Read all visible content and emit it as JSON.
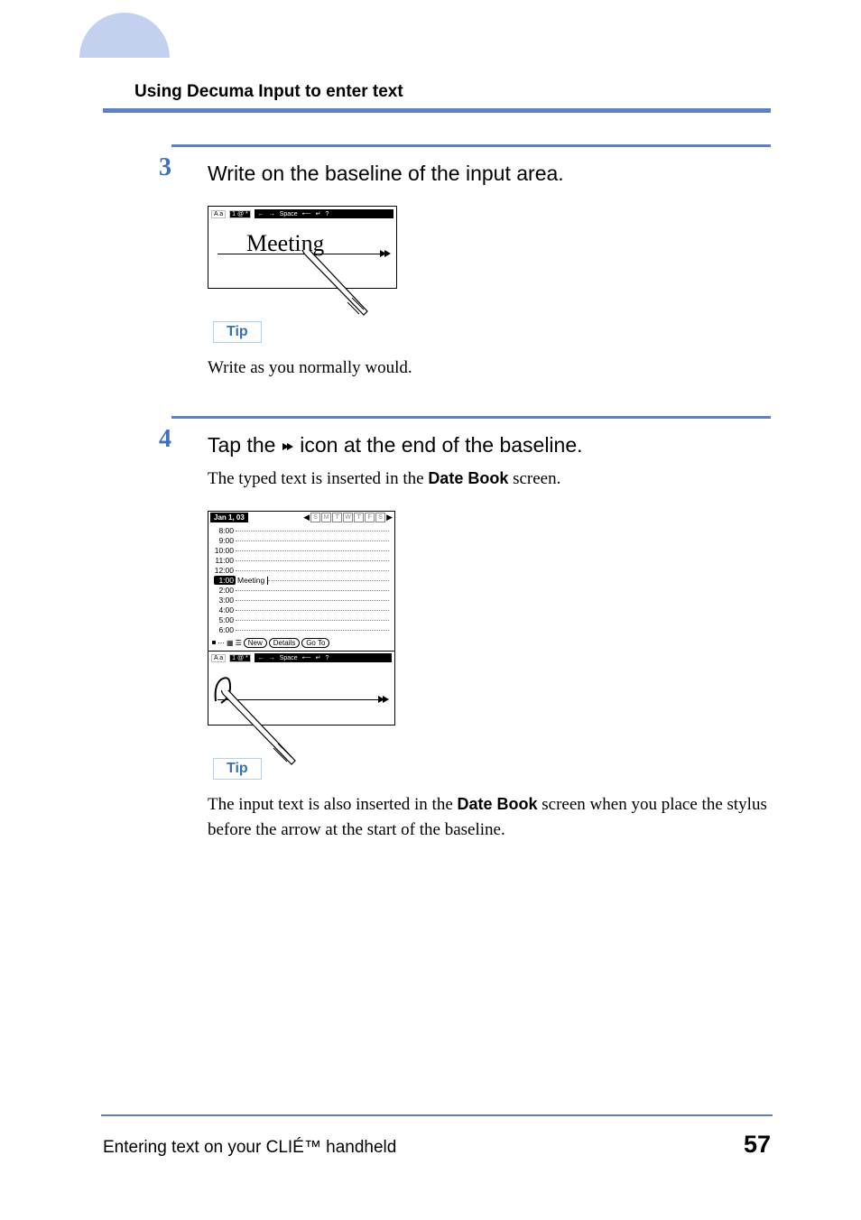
{
  "header": {
    "title": "Using Decuma Input to enter text"
  },
  "step3": {
    "number": "3",
    "heading": "Write on the baseline of the input area.",
    "tip_label": "Tip",
    "tip_text": "Write as you normally would.",
    "figure": {
      "toolbar": {
        "mode_text": "A a",
        "mode_num": "1 @ *",
        "actions": [
          "←",
          "→",
          "Space",
          "⟵",
          "↵",
          "?"
        ]
      },
      "written": "Meetin"
    }
  },
  "step4": {
    "number": "4",
    "heading_prefix": "Tap the ",
    "heading_suffix": " icon at the end of the baseline.",
    "body_prefix": "The typed text is inserted in the ",
    "body_bold": "Date Book",
    "body_suffix": " screen.",
    "figure": {
      "date": "Jan 1, 03",
      "weekdays": [
        "S",
        "M",
        "T",
        "W",
        "T",
        "F",
        "S"
      ],
      "hours": [
        "8:00",
        "9:00",
        "10:00",
        "11:00",
        "12:00"
      ],
      "selected": {
        "time": "1:00",
        "text": "Meeting"
      },
      "hours2": [
        "2:00",
        "3:00",
        "4:00",
        "5:00",
        "6:00"
      ],
      "buttons": [
        "New",
        "Details",
        "Go To"
      ],
      "toolbar": {
        "mode_text": "A a",
        "mode_num": "1 @ *",
        "actions": [
          "←",
          "→",
          "Space",
          "⟵",
          "↵",
          "?"
        ]
      }
    },
    "tip_label": "Tip",
    "tip_text_prefix": "The input text is also inserted in the ",
    "tip_bold": "Date Book",
    "tip_text_suffix": " screen when you place the stylus before the arrow at the start of the baseline."
  },
  "footer": {
    "text": "Entering text on your CLIÉ™ handheld",
    "page": "57"
  }
}
